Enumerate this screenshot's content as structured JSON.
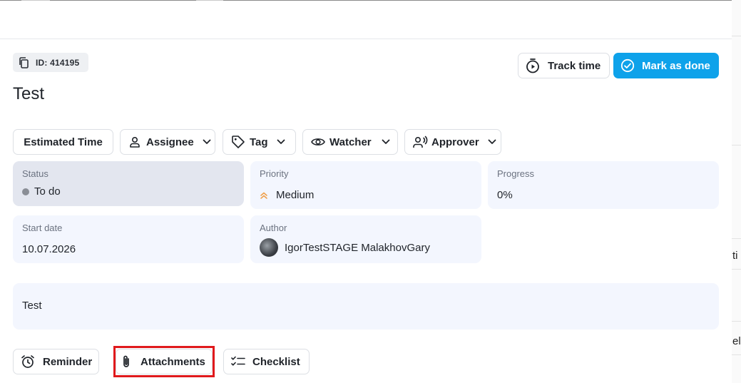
{
  "task": {
    "id_label": "ID: 414195",
    "title": "Test",
    "description": "Test"
  },
  "actions": {
    "track_time": "Track time",
    "mark_as_done": "Mark as done"
  },
  "fields_toolbar": {
    "estimated_time": "Estimated Time",
    "assignee": "Assignee",
    "tag": "Tag",
    "watcher": "Watcher",
    "approver": "Approver"
  },
  "cards": {
    "status": {
      "label": "Status",
      "value": "To do",
      "dot_color": "#8a8e96"
    },
    "priority": {
      "label": "Priority",
      "value": "Medium",
      "icon_color": "#f0a04b"
    },
    "progress": {
      "label": "Progress",
      "value": "0%",
      "fraction": 0
    },
    "start_date": {
      "label": "Start date",
      "value": "10.07.2026"
    },
    "author": {
      "label": "Author",
      "value": "IgorTestSTAGE MalakhovGary"
    }
  },
  "bottom_toolbar": {
    "reminder": "Reminder",
    "attachments": "Attachments",
    "checklist": "Checklist"
  },
  "side_panel_fragments": {
    "fragment_1": "ti",
    "fragment_2": "el"
  },
  "colors": {
    "primary": "#0ea2ea",
    "highlight": "#e0191c",
    "card_bg": "#f3f6fe",
    "status_card_bg": "#e3e6ef"
  }
}
